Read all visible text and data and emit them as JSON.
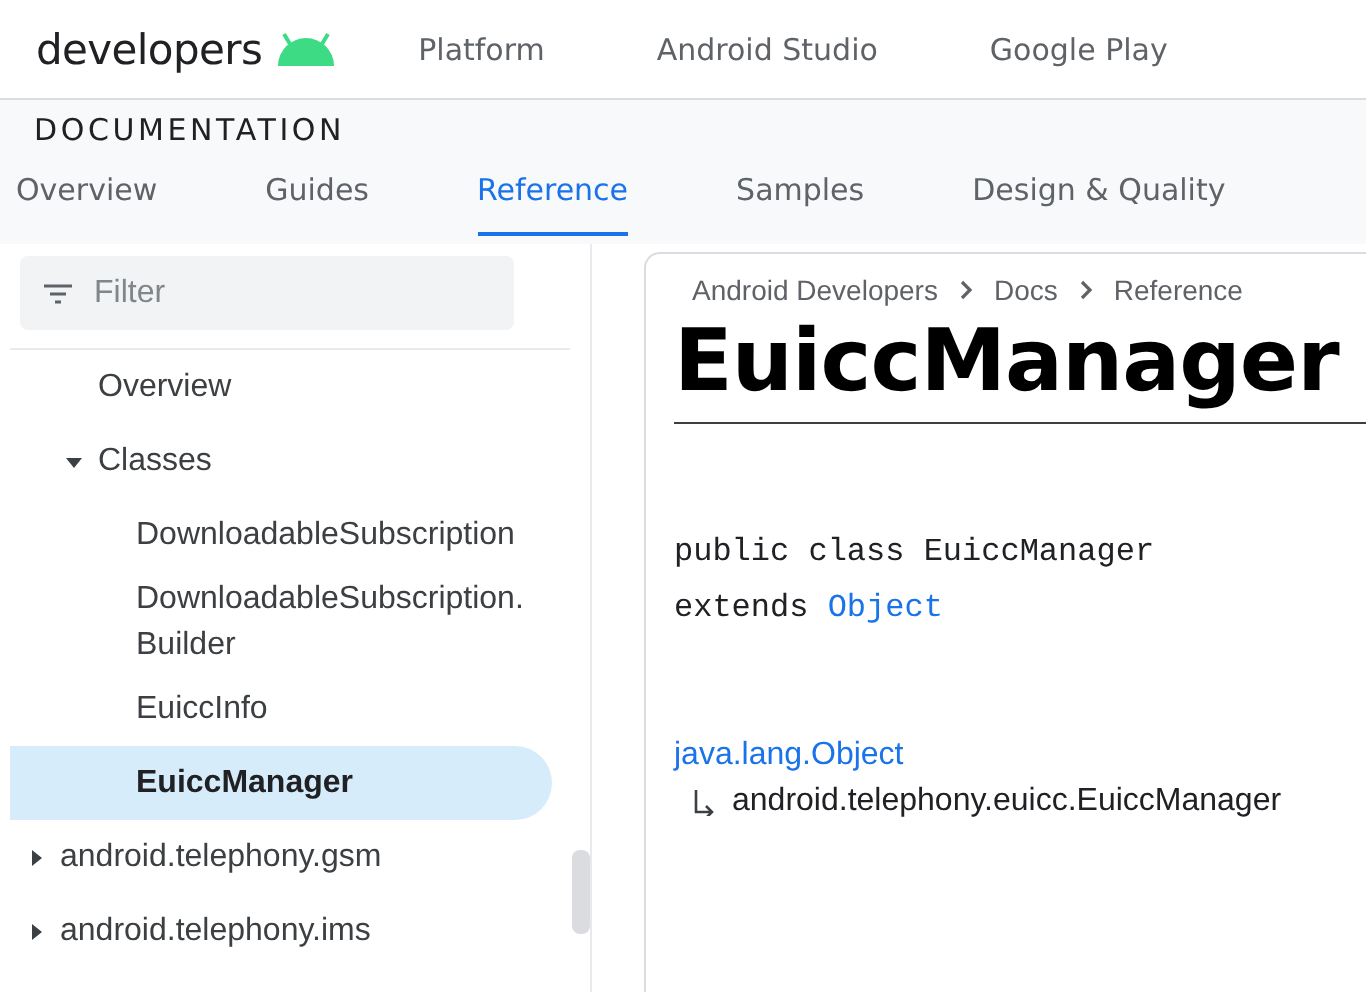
{
  "header": {
    "site_name": "developers",
    "nav": [
      {
        "label": "Platform"
      },
      {
        "label": "Android Studio"
      },
      {
        "label": "Google Play"
      }
    ]
  },
  "section": {
    "title": "DOCUMENTATION",
    "tabs": [
      {
        "label": "Overview",
        "selected": false
      },
      {
        "label": "Guides",
        "selected": false
      },
      {
        "label": "Reference",
        "selected": true
      },
      {
        "label": "Samples",
        "selected": false
      },
      {
        "label": "Design & Quality",
        "selected": false
      }
    ]
  },
  "sidebar": {
    "filter": {
      "placeholder": "Filter"
    },
    "tree": [
      {
        "children": [
          {
            "label": "Overview",
            "selected": false
          },
          {
            "label": "Classes",
            "selected": false,
            "expanded": true,
            "children": [
              {
                "label": "DownloadableSubscription",
                "selected": false
              },
              {
                "label": "DownloadableSubscription.\nBuilder",
                "selected": false
              },
              {
                "label": "EuiccInfo",
                "selected": false
              },
              {
                "label": "EuiccManager",
                "selected": true
              }
            ]
          }
        ]
      },
      {
        "label": "android.telephony.gsm",
        "selected": false,
        "expanded": false
      },
      {
        "label": "android.telephony.ims",
        "selected": false,
        "expanded": false
      }
    ]
  },
  "content": {
    "breadcrumbs": [
      "Android Developers",
      "Docs",
      "Reference"
    ],
    "title": "EuiccManager",
    "declaration": [
      {
        "text": "public class EuiccManager"
      },
      {
        "text": "extends ",
        "link": "Object"
      }
    ],
    "hierarchy": {
      "parent": "java.lang.Object",
      "child": "android.telephony.euicc.EuiccManager"
    }
  }
}
